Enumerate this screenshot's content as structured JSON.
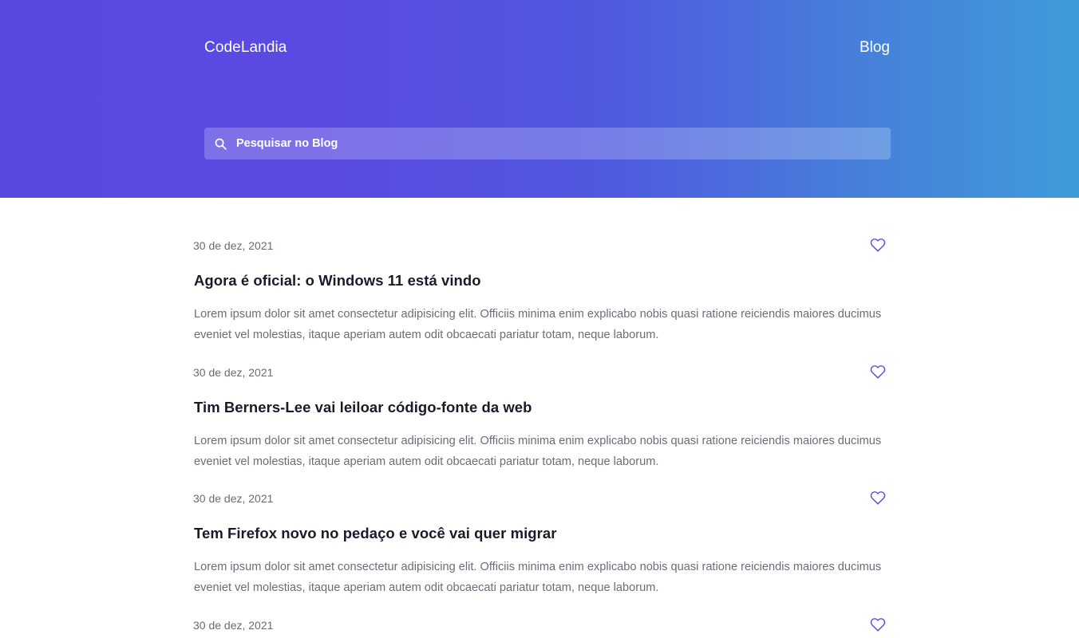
{
  "header": {
    "brand": "CodeLandia",
    "nav_link": "Blog",
    "search_placeholder": "Pesquisar no Blog"
  },
  "colors": {
    "gradient_start": "#5849e1",
    "gradient_end": "#3f9bd9",
    "heart": "#5b4ee2"
  },
  "posts": [
    {
      "date": "30 de dez, 2021",
      "title": "Agora é oficial: o Windows 11 está vindo",
      "body": "Lorem ipsum dolor sit amet consectetur adipisicing elit. Officiis minima enim explicabo nobis quasi ratione reiciendis maiores ducimus eveniet vel molestias, itaque aperiam autem odit obcaecati pariatur totam, neque laborum."
    },
    {
      "date": "30 de dez, 2021",
      "title": "Tim Berners-Lee vai leiloar código-fonte da web",
      "body": "Lorem ipsum dolor sit amet consectetur adipisicing elit. Officiis minima enim explicabo nobis quasi ratione reiciendis maiores ducimus eveniet vel molestias, itaque aperiam autem odit obcaecati pariatur totam, neque laborum."
    },
    {
      "date": "30 de dez, 2021",
      "title": "Tem Firefox novo no pedaço e você vai quer migrar",
      "body": "Lorem ipsum dolor sit amet consectetur adipisicing elit. Officiis minima enim explicabo nobis quasi ratione reiciendis maiores ducimus eveniet vel molestias, itaque aperiam autem odit obcaecati pariatur totam, neque laborum."
    },
    {
      "date": "30 de dez, 2021"
    }
  ]
}
